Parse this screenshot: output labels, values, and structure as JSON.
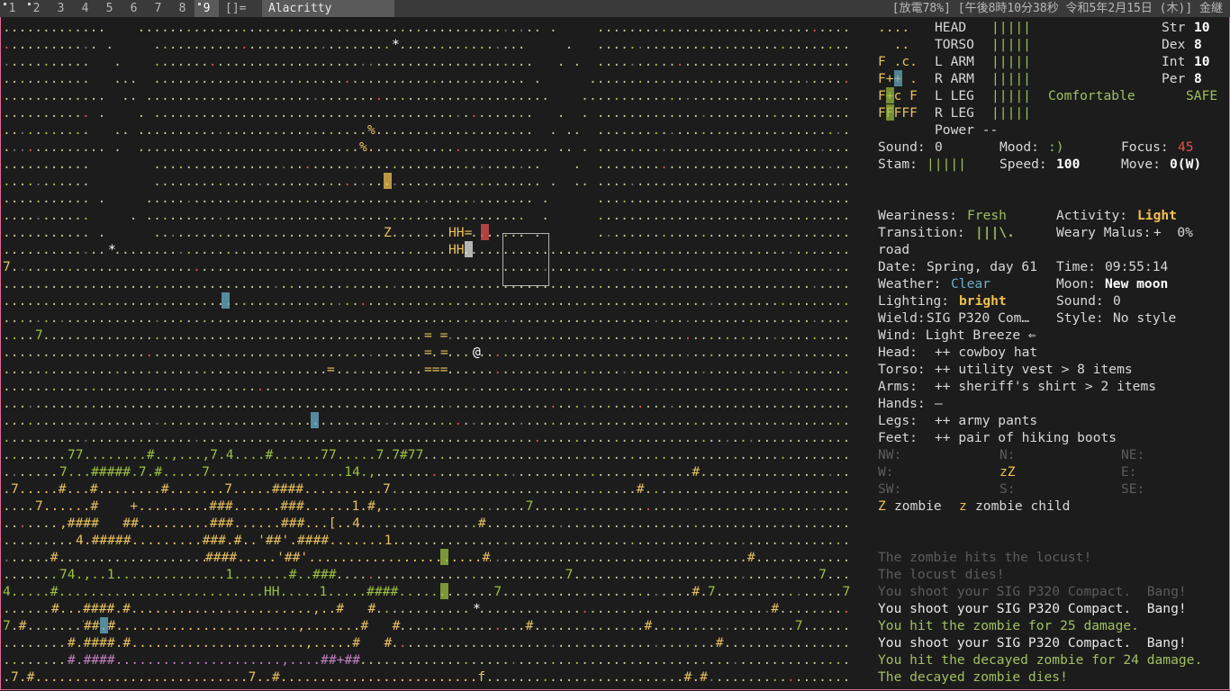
{
  "topbar": {
    "workspaces": [
      "1",
      "2",
      "3",
      "4",
      "5",
      "6",
      "7",
      "8",
      "9"
    ],
    "layout_symbol": "[]=",
    "window_title": "Alacritty",
    "battery": "[放電78%]",
    "datetime": "[午後8時10分38秒 令和5年2月15日 (木)]",
    "user": "金継"
  },
  "body_parts": [
    {
      "name": "HEAD",
      "bar": "|||||"
    },
    {
      "name": "TORSO",
      "bar": "|||||"
    },
    {
      "name": "L ARM",
      "bar": "|||||"
    },
    {
      "name": "R ARM",
      "bar": "|||||"
    },
    {
      "name": "L LEG",
      "bar": "|||||"
    },
    {
      "name": "R LEG",
      "bar": "|||||"
    }
  ],
  "temperature": "Comfortable",
  "safe_mode": "SAFE",
  "stats": {
    "str_label": "Str",
    "str": "10",
    "dex_label": "Dex",
    "dex": "8",
    "int_label": "Int",
    "int": "10",
    "per_label": "Per",
    "per": "8"
  },
  "power": "Power --",
  "mini_map": [
    "....",
    "  ..",
    "F .c.",
    "F++ .",
    "F+c F",
    "FFFFF"
  ],
  "status": {
    "sound_label": "Sound:",
    "sound": "0",
    "mood_label": "Mood:",
    "mood": ":)",
    "focus_label": "Focus:",
    "focus": "45",
    "stam_label": "Stam:",
    "stam": "|||||",
    "speed_label": "Speed:",
    "speed": "100",
    "move_label": "Move:",
    "move": "0(W)"
  },
  "info": {
    "weariness_label": "Weariness:",
    "weariness": "Fresh",
    "activity_label": "Activity:",
    "activity": "Light",
    "transition_label": "Transition:",
    "transition": "|||\\.",
    "weary_malus_label": "Weary Malus:",
    "weary_malus": "+  0%",
    "location": "road",
    "date_label": "Date:",
    "date": "Spring, day 61",
    "time_label": "Time:",
    "time": "09:55:14",
    "weather_label": "Weather:",
    "weather": "Clear",
    "moon_label": "Moon:",
    "moon": "New moon",
    "lighting_label": "Lighting:",
    "lighting": "bright",
    "sound2_label": "Sound:",
    "sound2": "0",
    "wield_label": "Wield:",
    "wield": "SIG P320 Com…",
    "style_label": "Style:",
    "style": "No style",
    "wind": "Wind: Light Breeze ⇐"
  },
  "equipment": [
    {
      "slot": "Head:",
      "item": "++ cowboy hat"
    },
    {
      "slot": "Torso:",
      "item": "++ utility vest > 8 items"
    },
    {
      "slot": "Arms:",
      "item": "++ sheriff's shirt > 2 items"
    },
    {
      "slot": "Hands:",
      "item": "–"
    },
    {
      "slot": "Legs:",
      "item": "++ army pants"
    },
    {
      "slot": "Feet:",
      "item": "++ pair of hiking boots"
    }
  ],
  "compass": {
    "nw": "NW:",
    "n": "N:",
    "ne": "NE:",
    "w": "W:",
    "center": "zZ",
    "e": "E:",
    "sw": "SW:",
    "s": "S:",
    "se": "SE:"
  },
  "monster_legend": [
    {
      "sym": "Z",
      "name": "zombie"
    },
    {
      "sym": "z",
      "name": "zombie child"
    }
  ],
  "messages": [
    {
      "text": "The zombie hits the locust!",
      "style": "dim"
    },
    {
      "text": "The locust dies!",
      "style": "dim"
    },
    {
      "text": "You shoot your SIG P320 Compact.  Bang!",
      "style": "dim"
    },
    {
      "text": "You shoot your SIG P320 Compact.  Bang!",
      "style": "white"
    },
    {
      "text": "You hit the zombie for 25 damage.",
      "style": "green"
    },
    {
      "text": "You shoot your SIG P320 Compact.  Bang!",
      "style": "white"
    },
    {
      "text": "You hit the decayed zombie for 24 damage.",
      "style": "green"
    },
    {
      "text": "The decayed zombie dies!",
      "style": "green"
    }
  ],
  "map": {
    "player": "@",
    "zombie_glyphs": [
      "Z",
      "Z"
    ],
    "vehicle_rows": [
      "HH=",
      "HH"
    ],
    "colors": {
      "ground": "#c9c39a",
      "grass": "#9bc040",
      "wall": "#e8c060",
      "player": "#ffffff",
      "blood": "#e05050",
      "frame_border": "#e06a9a"
    }
  }
}
